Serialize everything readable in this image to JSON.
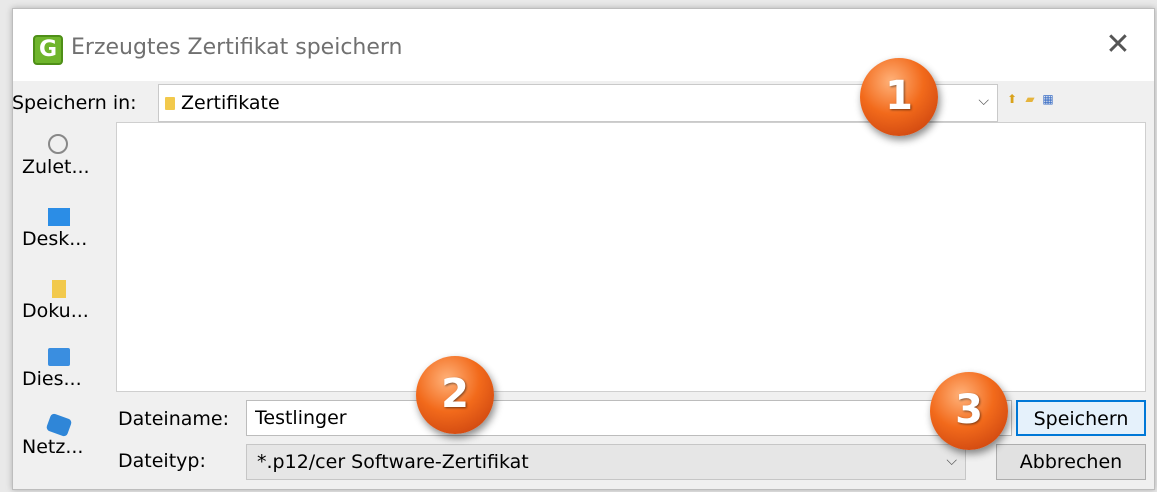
{
  "window": {
    "title": "Erzeugtes Zertifikat speichern",
    "app_icon_glyph": "G",
    "close_glyph": "✕"
  },
  "location": {
    "label": "Speichern in:",
    "value": "Zertifikate"
  },
  "places": [
    {
      "label": "Zulet...",
      "icon": "recent-icon"
    },
    {
      "label": "Desk...",
      "icon": "desktop-icon"
    },
    {
      "label": "Doku...",
      "icon": "documents-icon"
    },
    {
      "label": "Dies...",
      "icon": "this-pc-icon"
    },
    {
      "label": "Netz...",
      "icon": "network-icon"
    }
  ],
  "filename": {
    "label": "Dateiname:",
    "value": "Testlinger"
  },
  "filetype": {
    "label": "Dateityp:",
    "value": "*.p12/cer Software-Zertifikat"
  },
  "buttons": {
    "save": "Speichern",
    "cancel": "Abbrechen"
  },
  "markers": [
    "1",
    "2",
    "3"
  ],
  "colors": {
    "marker": "#f26a1b",
    "accent": "#0078d7",
    "app_icon": "#6fb52c"
  }
}
